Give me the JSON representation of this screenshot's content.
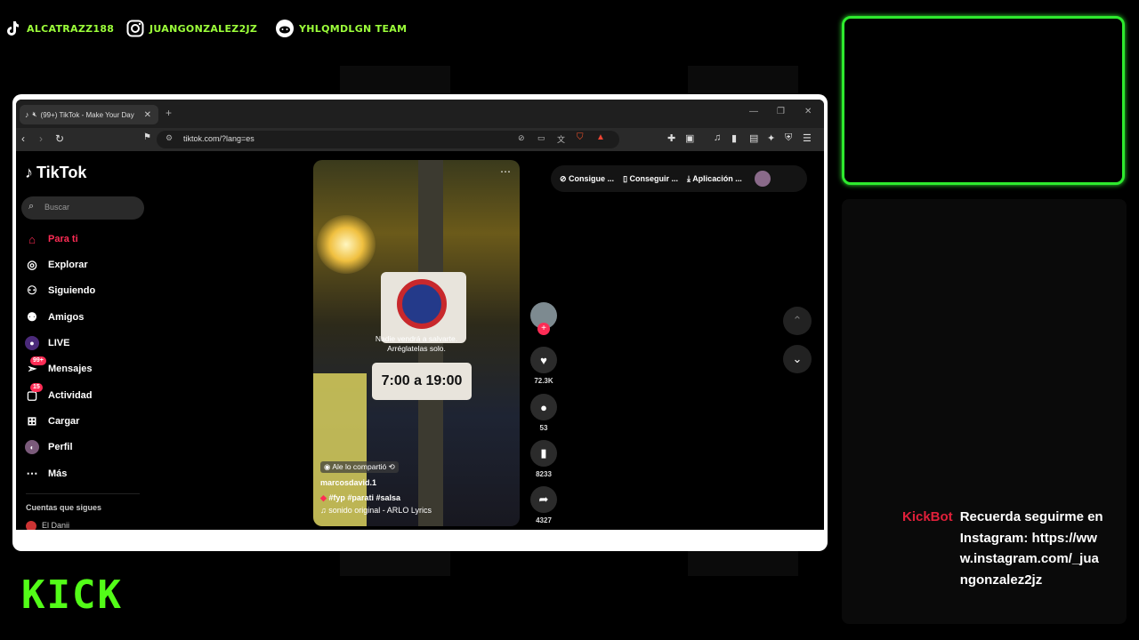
{
  "social": [
    {
      "icon": "tiktok-icon",
      "handle": "ALCATRAZZ188"
    },
    {
      "icon": "instagram-icon",
      "handle": "JUANGONZALEZ2JZ"
    },
    {
      "icon": "reddit-icon",
      "handle": "YHLQMDLGN TEAM"
    }
  ],
  "browser": {
    "tab_title": "(99+) TikTok - Make Your Day",
    "url": "tiktok.com/?lang=es"
  },
  "sidebar": {
    "logo": "TikTok",
    "search_placeholder": "Buscar",
    "items": [
      {
        "label": "Para ti",
        "icon": "home-icon"
      },
      {
        "label": "Explorar",
        "icon": "compass-icon"
      },
      {
        "label": "Siguiendo",
        "icon": "following-icon"
      },
      {
        "label": "Amigos",
        "icon": "friends-icon"
      },
      {
        "label": "LIVE",
        "icon": "live-icon"
      },
      {
        "label": "Mensajes",
        "icon": "messages-icon",
        "badge": "99+"
      },
      {
        "label": "Actividad",
        "icon": "activity-icon",
        "badge": "15"
      },
      {
        "label": "Cargar",
        "icon": "upload-icon"
      },
      {
        "label": "Perfil",
        "icon": "profile-icon"
      },
      {
        "label": "Más",
        "icon": "more-icon"
      }
    ],
    "following_title": "Cuentas que sigues",
    "following_first": "El Danii"
  },
  "top_actions": [
    "Consigue ...",
    "Conseguir ...",
    "Aplicación ..."
  ],
  "video": {
    "caption_line1": "Nadie vendrá a salvarte.",
    "caption_line2": "Arréglatelas solo.",
    "sign_text": "7:00 a 19:00",
    "shared_by": "Ale lo compartió",
    "author": "marcosdavid.1",
    "hashtags": "#fyp #parati #salsa",
    "sound": "sonido original - ARLO Lyrics",
    "likes": "72.3K",
    "comments": "53",
    "saves": "8233",
    "shares": "4327"
  },
  "chat": {
    "user": "KickBot",
    "message": "Recuerda seguirme en Instagram: https://www.instagram.com/_juangonzalez2jz"
  },
  "brand": {
    "logo_text": "KICK",
    "accent": "#53fc18"
  }
}
